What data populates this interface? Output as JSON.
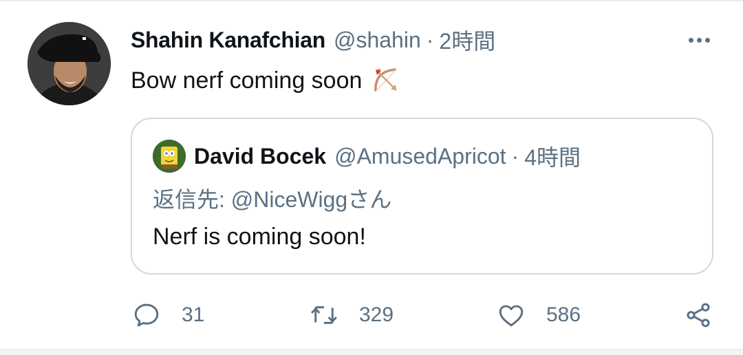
{
  "tweet": {
    "author_name": "Shahin Kanafchian",
    "author_handle": "@shahin",
    "separator": "·",
    "time": "2時間",
    "text": "Bow nerf coming soon",
    "emoji_icon": "bow-and-arrow-icon"
  },
  "quoted_tweet": {
    "author_name": "David Bocek",
    "author_handle": "@AmusedApricot",
    "separator": "·",
    "time": "4時間",
    "reply_to": "返信先: @NiceWiggさん",
    "text": "Nerf is coming soon!"
  },
  "actions": {
    "reply_count": "31",
    "retweet_count": "329",
    "like_count": "586"
  },
  "colors": {
    "text_primary": "#0f1419",
    "text_secondary": "#5b7083",
    "border": "#cfd9de"
  }
}
